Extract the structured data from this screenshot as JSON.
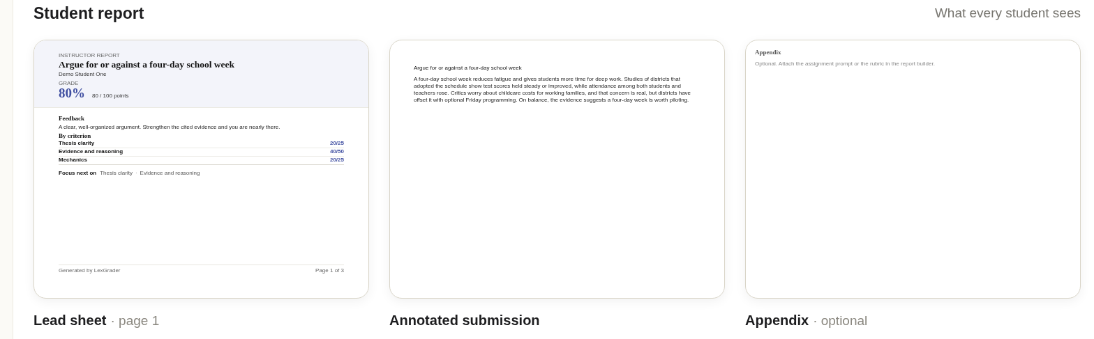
{
  "header": {
    "title": "Student report",
    "subtitle": "What every student sees"
  },
  "pages": [
    {
      "kind": "lead",
      "caption": "Lead sheet",
      "caption_note": "· page 1",
      "eyebrow": "INSTRUCTOR REPORT",
      "title": "Argue for or against a four-day school week",
      "student": "Demo Student One",
      "grade_label": "GRADE",
      "grade": "80%",
      "points": "80 / 100 points",
      "feedback_heading": "Feedback",
      "feedback": "A clear, well-organized argument. Strengthen the cited evidence and you are nearly there.",
      "criteria_heading": "By criterion",
      "criteria": [
        {
          "name": "Thesis clarity",
          "score": "20/25"
        },
        {
          "name": "Evidence and reasoning",
          "score": "40/50"
        },
        {
          "name": "Mechanics",
          "score": "20/25"
        }
      ],
      "focus_label": "Focus next on",
      "focus": [
        "Thesis clarity",
        "Evidence and reasoning"
      ],
      "focus_sep": "·",
      "footer_left": "Generated by LexGrader",
      "footer_right": "Page 1 of 3"
    },
    {
      "kind": "submission",
      "caption": "Annotated submission",
      "title": "Argue for or against a four-day school week",
      "body": "A four-day school week reduces fatigue and gives students more time for deep work. Studies of districts that adopted the schedule show test scores held steady or improved, while attendance among both students and teachers rose. Critics worry about childcare costs for working families, and that concern is real, but districts have offset it with optional Friday programming. On balance, the evidence suggests a four-day week is worth piloting."
    },
    {
      "kind": "appendix",
      "caption": "Appendix",
      "caption_note": "· optional",
      "title": "Appendix",
      "body": "Optional. Attach the assignment prompt or the rubric in the report builder."
    }
  ]
}
